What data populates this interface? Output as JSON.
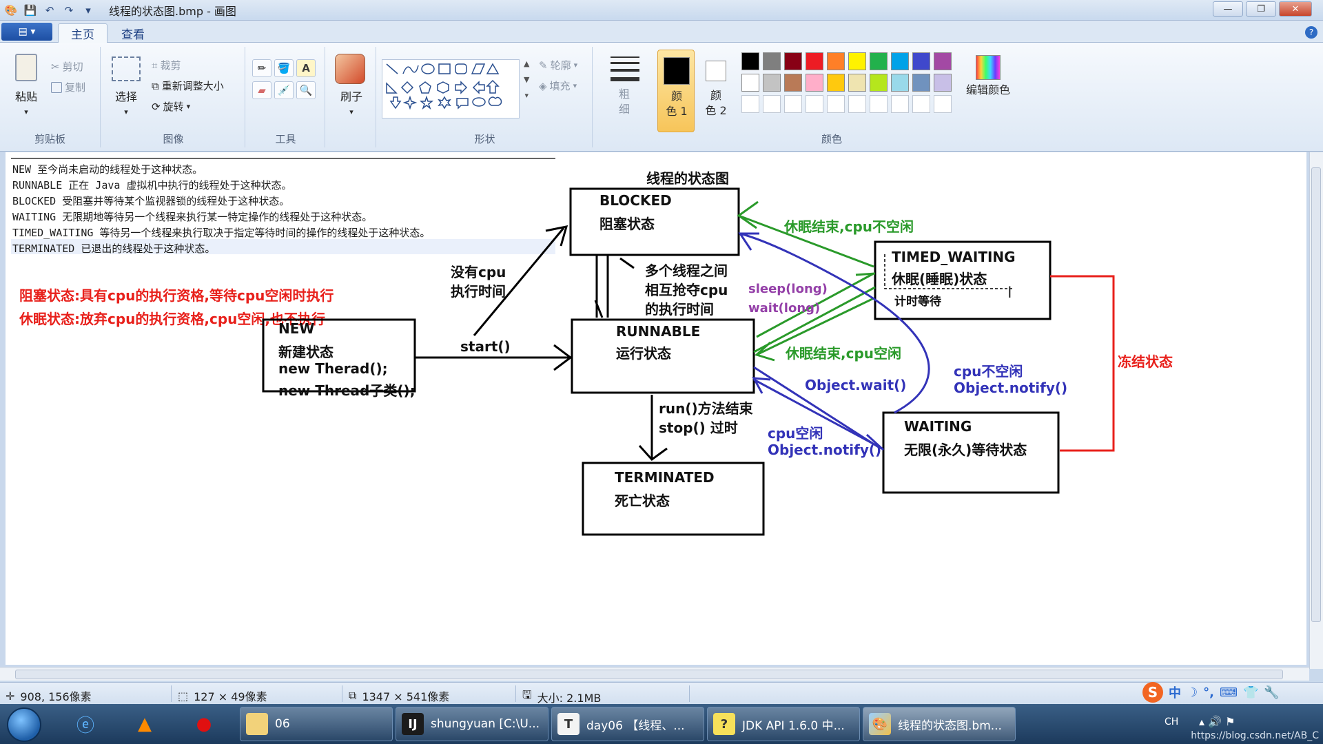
{
  "window": {
    "title": "线程的状态图.bmp - 画图",
    "controls": {
      "minimize": "—",
      "maximize": "❐",
      "close": "✕"
    }
  },
  "quick_access": {
    "save_icon": "💾",
    "undo_icon": "↶",
    "redo_icon": "↷",
    "customize_icon": "▾"
  },
  "menu": {
    "file_button": "▤ ▾",
    "tabs": [
      "主页",
      "查看"
    ],
    "help": "?"
  },
  "ribbon": {
    "clipboard": {
      "label": "剪贴板",
      "paste": "粘贴",
      "cut": "剪切",
      "copy": "复制"
    },
    "image": {
      "label": "图像",
      "select": "选择",
      "crop": "裁剪",
      "resize": "重新调整大小",
      "rotate": "旋转"
    },
    "tools": {
      "label": "工具"
    },
    "brushes": {
      "label": "刷子"
    },
    "shapes": {
      "label": "形状",
      "outline": "轮廓",
      "fill": "填充"
    },
    "size": {
      "label": "粗\n细"
    },
    "colors": {
      "label": "颜色",
      "color1": "颜\n色 1",
      "color2": "颜\n色 2",
      "edit": "编辑颜色",
      "row1": [
        "#000000",
        "#7f7f7f",
        "#880015",
        "#ed1c24",
        "#ff7f27",
        "#fff200",
        "#22b14c",
        "#00a2e8",
        "#3f48cc",
        "#a349a4"
      ],
      "row2": [
        "#ffffff",
        "#c3c3c3",
        "#b97a57",
        "#ffaec9",
        "#ffc90e",
        "#efe4b0",
        "#b5e61d",
        "#99d9ea",
        "#7092be",
        "#c8bfe7"
      ]
    }
  },
  "canvas": {
    "definitions": [
      "NEW 至今尚未启动的线程处于这种状态。",
      "RUNNABLE 正在 Java 虚拟机中执行的线程处于这种状态。",
      "BLOCKED 受阻塞并等待某个监视器锁的线程处于这种状态。",
      "WAITING 无限期地等待另一个线程来执行某一特定操作的线程处于这种状态。",
      "TIMED_WAITING 等待另一个线程来执行取决于指定等待时间的操作的线程处于这种状态。",
      "TERMINATED 已退出的线程处于这种状态。"
    ],
    "notes": [
      "阻塞状态:具有cpu的执行资格,等待cpu空闲时执行",
      "休眠状态:放弃cpu的执行资格,cpu空闲,也不执行"
    ],
    "diagram_title": "线程的状态图",
    "states": {
      "new": [
        "NEW",
        "新建状态",
        "new Therad();",
        "new Thread子类();"
      ],
      "runnable": [
        "RUNNABLE",
        "运行状态"
      ],
      "blocked": [
        "BLOCKED",
        "阻塞状态"
      ],
      "timed_waiting": [
        "TIMED_WAITING",
        "休眠(睡眠)状态",
        "计时等待"
      ],
      "waiting": [
        "WAITING",
        "无限(永久)等待状态"
      ],
      "terminated": [
        "TERMINATED",
        "死亡状态"
      ]
    },
    "edges": {
      "start": "start()",
      "no_cpu": [
        "没有cpu",
        "执行时间"
      ],
      "compete": [
        "多个线程之间",
        "相互抢夺cpu",
        "的执行时间"
      ],
      "sleep_end_busy": "休眠结束,cpu不空闲",
      "sleep_end_idle": "休眠结束,cpu空闲",
      "sleep_long": "sleep(long)",
      "wait_long": "wait(long)",
      "object_wait": "Object.wait()",
      "cpu_busy": [
        "cpu不空闲",
        "Object.notify()"
      ],
      "cpu_idle": [
        "cpu空闲",
        "Object.notify()"
      ],
      "run_end": [
        "run()方法结束",
        "stop() 过时"
      ],
      "frozen": "冻结状态"
    }
  },
  "statusbar": {
    "cursor": "908, 156像素",
    "selection": "127 × 49像素",
    "image_size": "1347 × 541像素",
    "file_size": "大小: 2.1MB"
  },
  "ime": [
    "中",
    "☽",
    "°,",
    "⌨",
    "👕",
    "🔧"
  ],
  "taskbar": {
    "tasks": [
      "06",
      "shungyuan [C:\\U...",
      "day06 【线程、...",
      "JDK API 1.6.0 中...",
      "线程的状态图.bm..."
    ],
    "tray_lang": "CH",
    "watermark": "https://blog.csdn.net/AB_C"
  }
}
